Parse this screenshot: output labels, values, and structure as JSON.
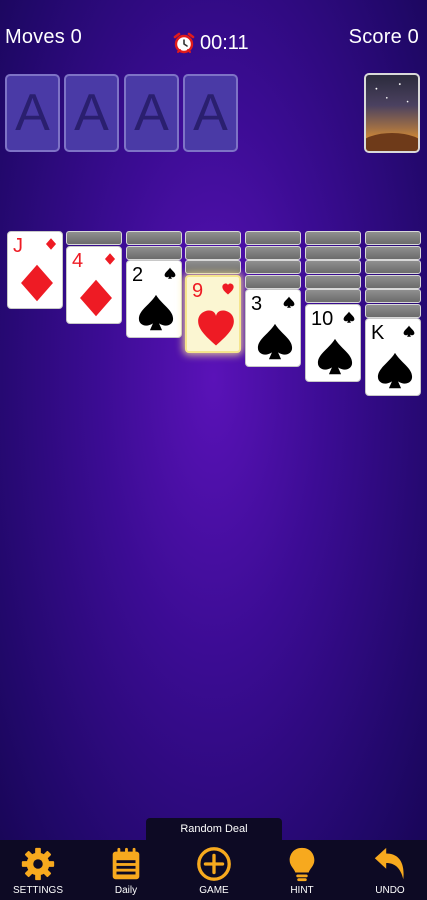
{
  "hud": {
    "moves": "Moves 0",
    "timer": "00:11",
    "score": "Score 0"
  },
  "foundations": [
    {
      "label": "A"
    },
    {
      "label": "A"
    },
    {
      "label": "A"
    },
    {
      "label": "A"
    }
  ],
  "tableau": [
    {
      "hidden": 0,
      "card": {
        "rank": "J",
        "suit": "diamonds",
        "color": "red"
      }
    },
    {
      "hidden": 1,
      "card": {
        "rank": "4",
        "suit": "diamonds",
        "color": "red"
      }
    },
    {
      "hidden": 2,
      "card": {
        "rank": "2",
        "suit": "spades",
        "color": "black"
      }
    },
    {
      "hidden": 3,
      "card": {
        "rank": "9",
        "suit": "hearts",
        "color": "red",
        "highlighted": true
      }
    },
    {
      "hidden": 4,
      "card": {
        "rank": "3",
        "suit": "spades",
        "color": "black"
      }
    },
    {
      "hidden": 5,
      "card": {
        "rank": "10",
        "suit": "spades",
        "color": "black"
      }
    },
    {
      "hidden": 6,
      "card": {
        "rank": "K",
        "suit": "spades",
        "color": "black"
      }
    }
  ],
  "random_deal_label": "Random Deal",
  "toolbar": [
    {
      "name": "settings",
      "label": "SETTINGS",
      "icon": "gear-icon"
    },
    {
      "name": "daily",
      "label": "Daily",
      "icon": "calendar-icon"
    },
    {
      "name": "game",
      "label": "GAME",
      "icon": "plus-circle-icon"
    },
    {
      "name": "hint",
      "label": "HINT",
      "icon": "lightbulb-icon"
    },
    {
      "name": "undo",
      "label": "UNDO",
      "icon": "undo-arrow-icon"
    }
  ],
  "colors": {
    "accent": "#f7a91e",
    "red_suit": "#ee1b24",
    "black_suit": "#000000"
  }
}
